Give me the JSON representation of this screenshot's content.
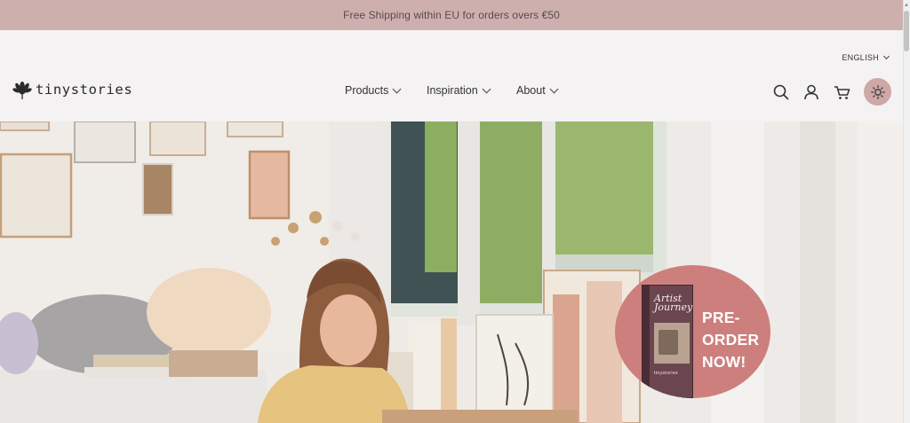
{
  "announcement": "Free Shipping within EU for orders overs €50",
  "header": {
    "language": "ENGLISH",
    "logo_text": "tinystories",
    "nav": [
      {
        "label": "Products"
      },
      {
        "label": "Inspiration"
      },
      {
        "label": "About"
      }
    ],
    "icons": [
      "search-icon",
      "account-icon",
      "cart-icon",
      "sun-icon"
    ]
  },
  "hero": {
    "badge": {
      "book_title": "Artist Journey",
      "book_subtitle": "tinystories",
      "text": "PRE-ORDER NOW!"
    }
  },
  "colors": {
    "announcement_bg": "#cdb0ae",
    "header_bg": "#f4f2f3",
    "badge_bg": "#cd7f7d",
    "theme_button_bg": "#cda8a6"
  }
}
